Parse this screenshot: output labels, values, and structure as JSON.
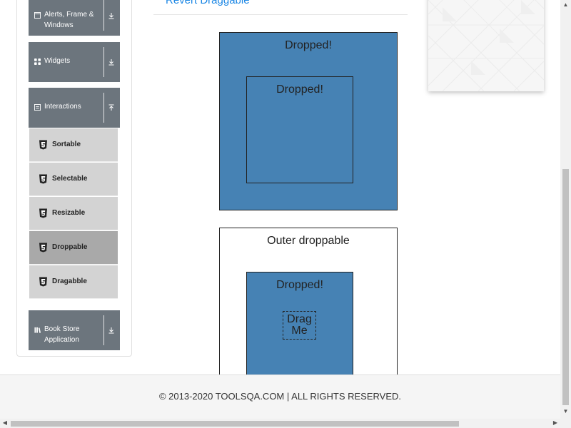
{
  "sidebar": {
    "groups": [
      {
        "label_line1": "Alerts, Frame &",
        "label_line2": "Windows",
        "icon": "window-icon",
        "arrow": "download-arrow-icon"
      },
      {
        "label": "Widgets",
        "icon": "grid-icon",
        "arrow": "download-arrow-icon"
      },
      {
        "label": "Interactions",
        "icon": "list-icon",
        "arrow": "upload-arrow-icon"
      },
      {
        "label_line1": "Book Store",
        "label_line2": "Application",
        "icon": "book-icon",
        "arrow": "download-arrow-icon"
      }
    ],
    "items": [
      {
        "label": "Sortable",
        "active": false
      },
      {
        "label": "Selectable",
        "active": false
      },
      {
        "label": "Resizable",
        "active": false
      },
      {
        "label": "Droppable",
        "active": true
      },
      {
        "label": "Dragabble",
        "active": false
      }
    ]
  },
  "main": {
    "tab_link": "Revert Draggable",
    "greedy": {
      "outer_text": "Dropped!",
      "inner_text": "Dropped!"
    },
    "nested": {
      "outer_text": "Outer droppable",
      "inner_text": "Dropped!",
      "drag_line1": "Drag",
      "drag_line2": "Me"
    }
  },
  "footer": {
    "text": "© 2013-2020 TOOLSQA.COM | ALL RIGHTS RESERVED."
  },
  "colors": {
    "dropped_bg": "#4682b4",
    "sidebar_group_bg": "#6c757d",
    "sidebar_item_bg": "#d3d3d3",
    "sidebar_item_active_bg": "#a9a9a9",
    "link": "#1e88e5"
  }
}
